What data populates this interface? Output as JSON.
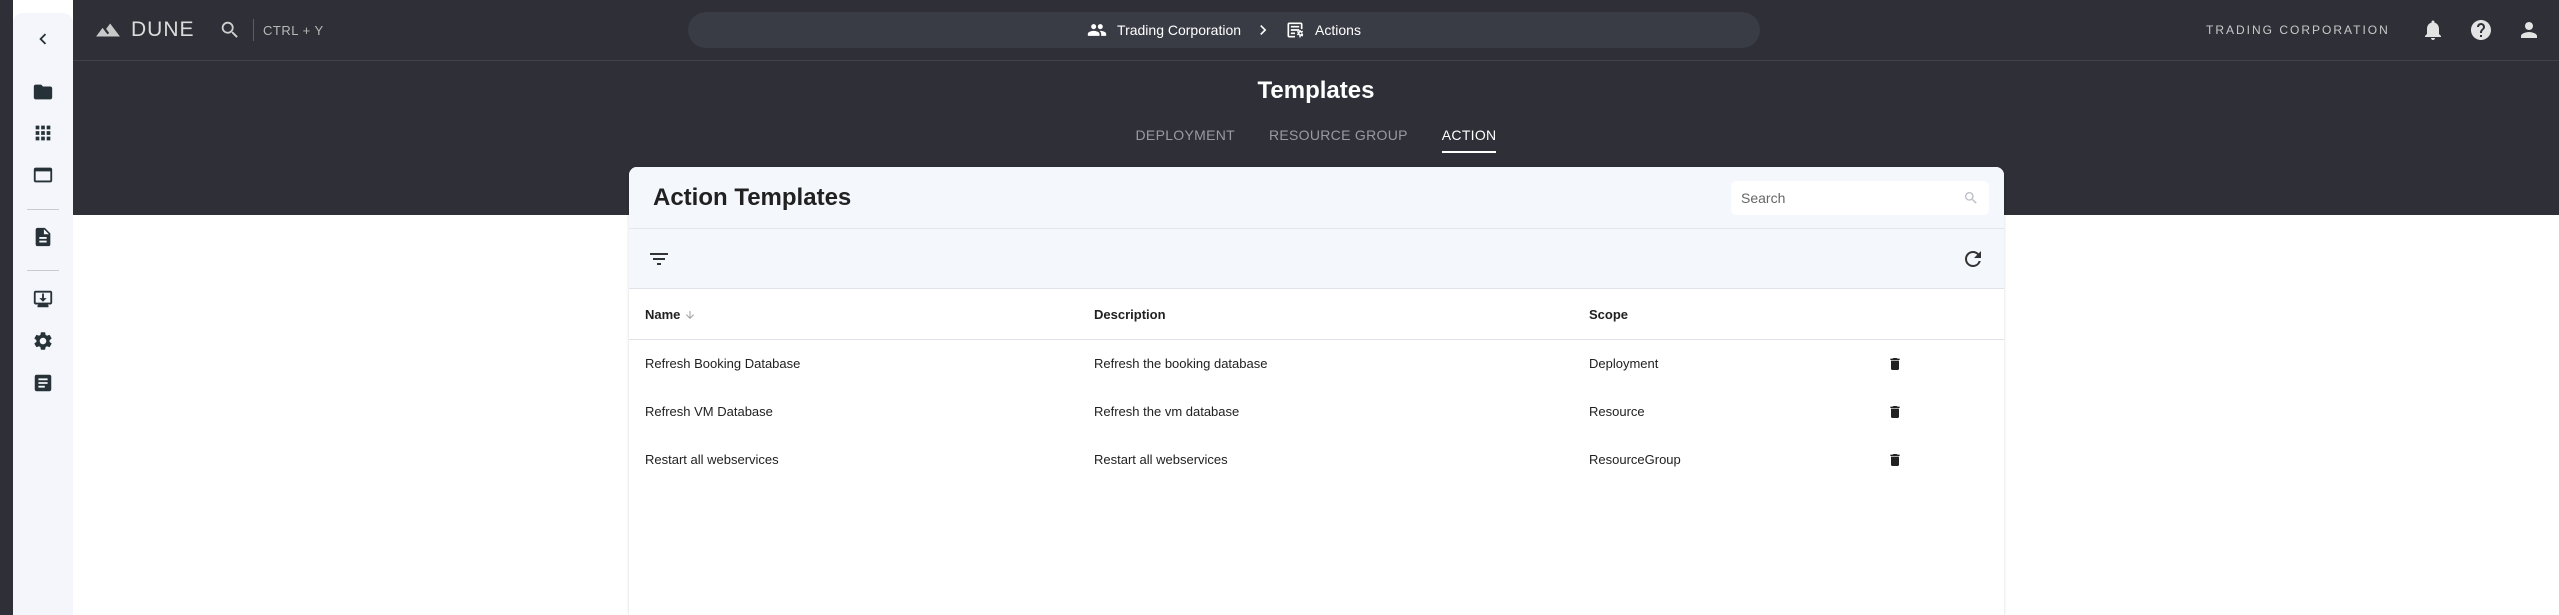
{
  "topbar": {
    "brand": "DUNE",
    "shortcut": "CTRL + Y",
    "org_name": "TRADING CORPORATION"
  },
  "breadcrumb": {
    "items": [
      {
        "label": "Trading Corporation",
        "icon": "group-icon"
      },
      {
        "label": "Actions",
        "icon": "actions-list-icon"
      }
    ]
  },
  "sidebar": {
    "items": [
      {
        "icon": "collapse-chevron-icon"
      },
      {
        "icon": "folder-icon"
      },
      {
        "icon": "apps-grid-icon"
      },
      {
        "icon": "window-icon"
      },
      {
        "icon": "document-icon"
      },
      {
        "icon": "deploy-icon"
      },
      {
        "icon": "settings-gear-icon"
      },
      {
        "icon": "notes-icon"
      }
    ]
  },
  "page": {
    "title": "Templates",
    "tabs": [
      {
        "label": "DEPLOYMENT",
        "active": false
      },
      {
        "label": "RESOURCE GROUP",
        "active": false
      },
      {
        "label": "ACTION",
        "active": true
      }
    ]
  },
  "card": {
    "title": "Action Templates",
    "search_placeholder": "Search",
    "columns": [
      "Name",
      "Description",
      "Scope"
    ],
    "rows": [
      {
        "name": "Refresh Booking Database",
        "description": "Refresh the booking database",
        "scope": "Deployment"
      },
      {
        "name": "Refresh VM Database",
        "description": "Refresh the vm database",
        "scope": "Resource"
      },
      {
        "name": "Restart all webservices",
        "description": "Restart all webservices",
        "scope": "ResourceGroup"
      }
    ]
  },
  "colors": {
    "dark_bg": "#2e2f37",
    "breadcrumb_bg": "#3a3c45",
    "sidebar_bg": "#f4f6fb",
    "card_header_bg": "#f4f7fc"
  }
}
